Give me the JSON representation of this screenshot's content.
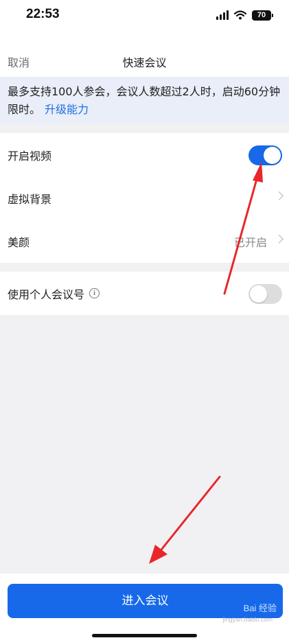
{
  "status_bar": {
    "time": "22:53",
    "battery": "70"
  },
  "nav": {
    "cancel": "取消",
    "title": "快速会议"
  },
  "notice": {
    "text": "最多支持100人参会，会议人数超过2人时，启动60分钟限时。",
    "link": "升级能力"
  },
  "settings": {
    "video": {
      "label": "开启视频",
      "enabled": true
    },
    "background": {
      "label": "虚拟背景"
    },
    "beauty": {
      "label": "美颜",
      "value": "已开启"
    },
    "personal_id": {
      "label": "使用个人会议号",
      "enabled": false
    }
  },
  "enter_button": "进入会议",
  "watermark": {
    "text": "Bai 经验",
    "sub": "jingyan.baidu.com"
  },
  "colors": {
    "accent": "#1769ea",
    "annotation_arrow": "#e8262b",
    "notice_bg": "#e9eef9"
  }
}
